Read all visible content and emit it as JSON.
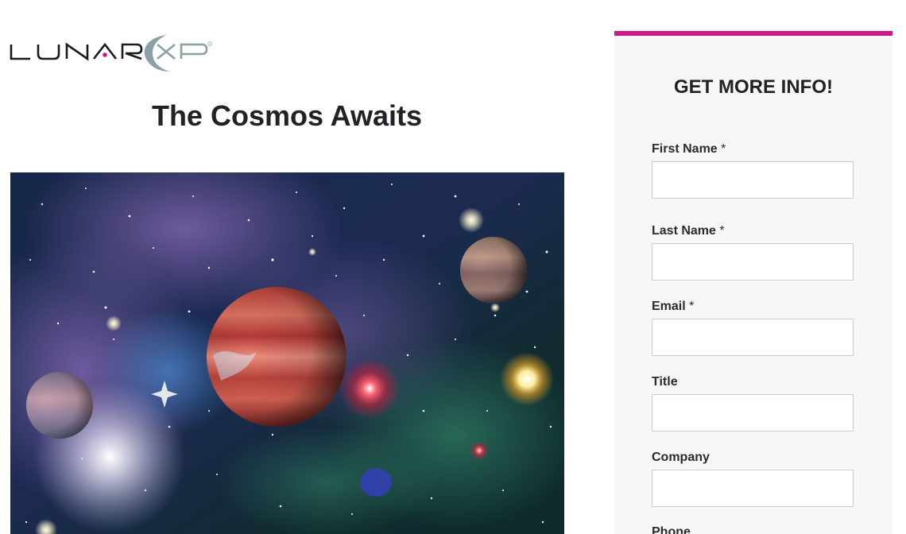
{
  "logo": {
    "brand_text": "LUNAR XP",
    "icon": "lunar-xp-logo"
  },
  "headline": "The Cosmos Awaits",
  "hero_image": {
    "icon": "space-planets-nebula-image"
  },
  "form": {
    "title": "GET MORE INFO!",
    "fields": [
      {
        "label": "First Name",
        "required_mark": "*",
        "value": ""
      },
      {
        "label": "Last Name",
        "required_mark": "*",
        "value": ""
      },
      {
        "label": "Email",
        "required_mark": "*",
        "value": ""
      },
      {
        "label": "Title",
        "required_mark": "",
        "value": ""
      },
      {
        "label": "Company",
        "required_mark": "",
        "value": ""
      },
      {
        "label": "Phone",
        "required_mark": "",
        "value": ""
      }
    ]
  },
  "colors": {
    "accent": "#cc1a8c",
    "panel_bg": "#f7f7f7",
    "text_dark": "#222226",
    "logo_gray": "#8ca0a8"
  }
}
